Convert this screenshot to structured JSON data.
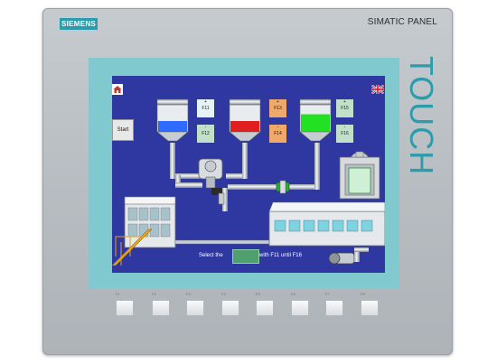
{
  "device": {
    "brand": "SIEMENS",
    "model": "SIMATIC PANEL",
    "touch_label": "TOUCH",
    "brand_color": "#2a9cab",
    "bezel_color": "#7fc9cf",
    "screen_color": "#2f38a0"
  },
  "screen": {
    "start_button": "Start",
    "home_icon": "home-icon",
    "language_icon": "uk-flag-icon",
    "tanks": [
      {
        "color": "#2f6bff",
        "level": 0.4,
        "fkey_up": {
          "sign": "+",
          "label": "F11"
        },
        "fkey_down": {
          "sign": "-",
          "label": "F12"
        }
      },
      {
        "color": "#e02020",
        "level": 0.4,
        "fkey_up": {
          "sign": "+",
          "label": "F13"
        },
        "fkey_down": {
          "sign": "-",
          "label": "F14"
        }
      },
      {
        "color": "#22e022",
        "level": 0.65,
        "fkey_up": {
          "sign": "+",
          "label": "F15"
        },
        "fkey_down": {
          "sign": "-",
          "label": "F16"
        }
      }
    ],
    "instruction": {
      "left": "Select the",
      "right": "with F11 until F16"
    }
  },
  "softkeys": [
    {
      "label": "F1"
    },
    {
      "label": "F2"
    },
    {
      "label": "F3"
    },
    {
      "label": "F4"
    },
    {
      "label": "F5"
    },
    {
      "label": "F6"
    },
    {
      "label": "F7"
    },
    {
      "label": "F8"
    }
  ]
}
